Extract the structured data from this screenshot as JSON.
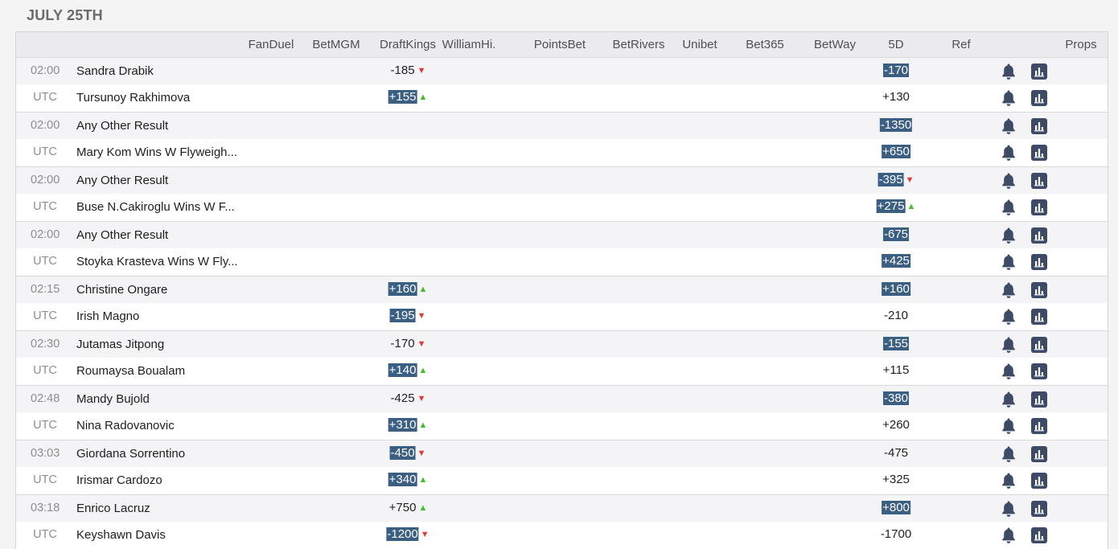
{
  "date_heading": "JULY 25TH",
  "columns": [
    "FanDuel",
    "BetMGM",
    "DraftKings",
    "WilliamHi.",
    "PointsBet",
    "BetRivers",
    "Unibet",
    "Bet365",
    "BetWay",
    "5D",
    "Ref",
    "Props"
  ],
  "colors": {
    "highlight": "#3b5e83",
    "up_arrow": "#3fbf2a",
    "down_arrow": "#e53935",
    "icon": "#3d4b66"
  },
  "icons": {
    "alert": "bell-icon",
    "chart": "bar-chart-icon"
  },
  "events": [
    {
      "time": "02:00",
      "tz": "UTC",
      "a": {
        "name": "Sandra Drabik",
        "draftkings": {
          "value": "-185",
          "highlight": false,
          "arrow": "down"
        },
        "fived": {
          "value": "-170",
          "highlight": true,
          "arrow": ""
        }
      },
      "b": {
        "name": "Tursunoy Rakhimova",
        "draftkings": {
          "value": "+155",
          "highlight": true,
          "arrow": "up"
        },
        "fived": {
          "value": "+130",
          "highlight": false,
          "arrow": ""
        }
      }
    },
    {
      "time": "02:00",
      "tz": "UTC",
      "a": {
        "name": "Any Other Result",
        "draftkings": null,
        "fived": {
          "value": "-1350",
          "highlight": true,
          "arrow": ""
        }
      },
      "b": {
        "name": "Mary Kom Wins W Flyweigh...",
        "draftkings": null,
        "fived": {
          "value": "+650",
          "highlight": true,
          "arrow": ""
        }
      }
    },
    {
      "time": "02:00",
      "tz": "UTC",
      "a": {
        "name": "Any Other Result",
        "draftkings": null,
        "fived": {
          "value": "-395",
          "highlight": true,
          "arrow": "down"
        }
      },
      "b": {
        "name": "Buse N.Cakiroglu Wins W F...",
        "draftkings": null,
        "fived": {
          "value": "+275",
          "highlight": true,
          "arrow": "up"
        }
      }
    },
    {
      "time": "02:00",
      "tz": "UTC",
      "a": {
        "name": "Any Other Result",
        "draftkings": null,
        "fived": {
          "value": "-675",
          "highlight": true,
          "arrow": ""
        }
      },
      "b": {
        "name": "Stoyka Krasteva Wins W Fly...",
        "draftkings": null,
        "fived": {
          "value": "+425",
          "highlight": true,
          "arrow": ""
        }
      }
    },
    {
      "time": "02:15",
      "tz": "UTC",
      "a": {
        "name": "Christine Ongare",
        "draftkings": {
          "value": "+160",
          "highlight": true,
          "arrow": "up"
        },
        "fived": {
          "value": "+160",
          "highlight": true,
          "arrow": ""
        }
      },
      "b": {
        "name": "Irish Magno",
        "draftkings": {
          "value": "-195",
          "highlight": true,
          "arrow": "down"
        },
        "fived": {
          "value": "-210",
          "highlight": false,
          "arrow": ""
        }
      }
    },
    {
      "time": "02:30",
      "tz": "UTC",
      "a": {
        "name": "Jutamas Jitpong",
        "draftkings": {
          "value": "-170",
          "highlight": false,
          "arrow": "down"
        },
        "fived": {
          "value": "-155",
          "highlight": true,
          "arrow": ""
        }
      },
      "b": {
        "name": "Roumaysa Boualam",
        "draftkings": {
          "value": "+140",
          "highlight": true,
          "arrow": "up"
        },
        "fived": {
          "value": "+115",
          "highlight": false,
          "arrow": ""
        }
      }
    },
    {
      "time": "02:48",
      "tz": "UTC",
      "a": {
        "name": "Mandy Bujold",
        "draftkings": {
          "value": "-425",
          "highlight": false,
          "arrow": "down"
        },
        "fived": {
          "value": "-380",
          "highlight": true,
          "arrow": ""
        }
      },
      "b": {
        "name": "Nina Radovanovic",
        "draftkings": {
          "value": "+310",
          "highlight": true,
          "arrow": "up"
        },
        "fived": {
          "value": "+260",
          "highlight": false,
          "arrow": ""
        }
      }
    },
    {
      "time": "03:03",
      "tz": "UTC",
      "a": {
        "name": "Giordana Sorrentino",
        "draftkings": {
          "value": "-450",
          "highlight": true,
          "arrow": "down"
        },
        "fived": {
          "value": "-475",
          "highlight": false,
          "arrow": ""
        }
      },
      "b": {
        "name": "Irismar Cardozo",
        "draftkings": {
          "value": "+340",
          "highlight": true,
          "arrow": "up"
        },
        "fived": {
          "value": "+325",
          "highlight": false,
          "arrow": ""
        }
      }
    },
    {
      "time": "03:18",
      "tz": "UTC",
      "a": {
        "name": "Enrico Lacruz",
        "draftkings": {
          "value": "+750",
          "highlight": false,
          "arrow": "up"
        },
        "fived": {
          "value": "+800",
          "highlight": true,
          "arrow": ""
        }
      },
      "b": {
        "name": "Keyshawn Davis",
        "draftkings": {
          "value": "-1200",
          "highlight": true,
          "arrow": "down"
        },
        "fived": {
          "value": "-1700",
          "highlight": false,
          "arrow": ""
        }
      }
    }
  ]
}
